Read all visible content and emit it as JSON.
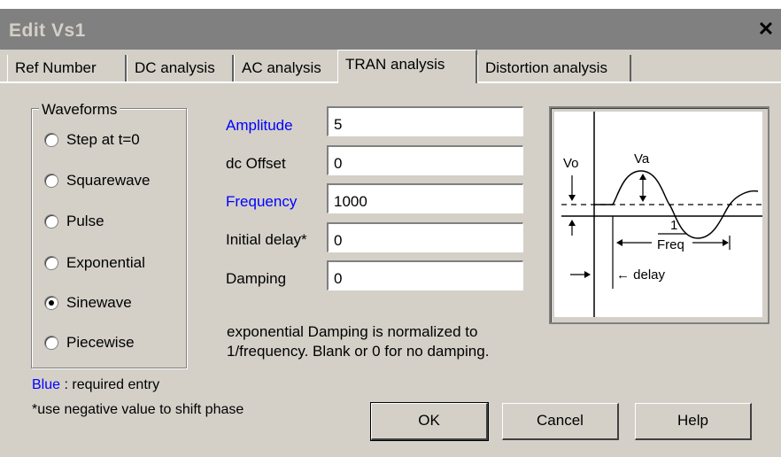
{
  "window": {
    "title": "Edit Vs1",
    "close_icon": "close-icon"
  },
  "tabs": [
    {
      "label": "Ref Number",
      "selected": false
    },
    {
      "label": "DC analysis",
      "selected": false
    },
    {
      "label": "AC analysis",
      "selected": false
    },
    {
      "label": "TRAN analysis",
      "selected": true
    },
    {
      "label": "Distortion analysis",
      "selected": false
    }
  ],
  "waveforms": {
    "title": "Waveforms",
    "options": [
      {
        "label": "Step at t=0",
        "checked": false
      },
      {
        "label": "Squarewave",
        "checked": false
      },
      {
        "label": "Pulse",
        "checked": false
      },
      {
        "label": "Exponential",
        "checked": false
      },
      {
        "label": "Sinewave",
        "checked": true
      },
      {
        "label": "Piecewise",
        "checked": false
      }
    ]
  },
  "fields": [
    {
      "label": "Amplitude",
      "value": "5",
      "required": true
    },
    {
      "label": "dc Offset",
      "value": "0",
      "required": false
    },
    {
      "label": "Frequency",
      "value": "1000",
      "required": true
    },
    {
      "label": "Initial delay*",
      "value": "0",
      "required": false
    },
    {
      "label": "Damping",
      "value": "0",
      "required": false
    }
  ],
  "note": {
    "line1": "exponential Damping is normalized to",
    "line2": "1/frequency.  Blank or 0 for no damping."
  },
  "diagram": {
    "vo": "Vo",
    "va": "Va",
    "freq_num": "1",
    "freq_den": "Freq",
    "delay": "← delay"
  },
  "legend": {
    "blue_word": "Blue",
    "blue_rest": " :  required entry",
    "phase_note": "*use negative value to shift phase"
  },
  "buttons": {
    "ok": "OK",
    "cancel": "Cancel",
    "help": "Help"
  },
  "colors": {
    "required": "#0000ff",
    "face": "#d4d0c8",
    "title_bar": "#808080"
  }
}
